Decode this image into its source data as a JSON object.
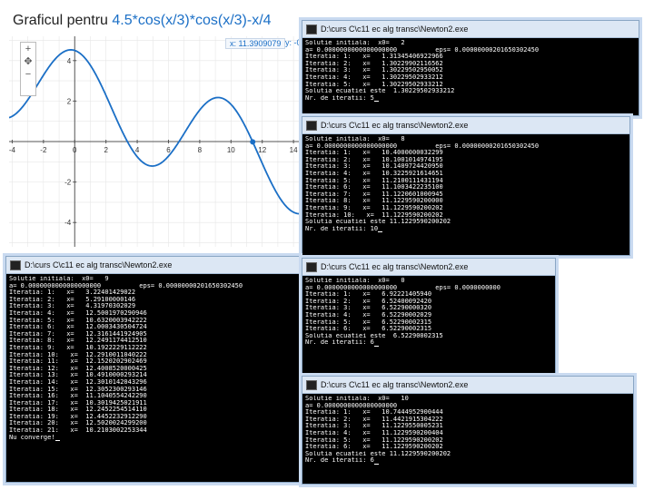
{
  "graph": {
    "title_prefix": "Graficul pentru ",
    "function": "4.5*cos(x/3)*cos(x/3)-x/4",
    "x_readout": "x: 11.3909079",
    "y_readout": "y: -0",
    "zoom_in": "+",
    "zoom_out": "−",
    "x_ticks": [
      "-4",
      "-2",
      "0",
      "2",
      "4",
      "6",
      "8",
      "10",
      "12",
      "14"
    ],
    "y_ticks": [
      "4",
      "2",
      "-2",
      "-4"
    ],
    "colors": {
      "curve": "#1b6fc6",
      "axis": "#555555",
      "grid": "#e6e6e6"
    }
  },
  "consoles": [
    {
      "title": "D:\\curs C\\c11 ec alg transc\\Newton2.exe",
      "lines": [
        "Solutie initiala:  x0=   2",
        "a= 0.0000000000000000000          eps= 0.00000000201650302450",
        "Iteratia: 1:   x=   1.31345406922966",
        "Iteratia: 2:   x=   1.30229902116562",
        "Iteratia: 3:   x=   1.30229502950052",
        "Iteratia: 4:   x=   1.30229502933212",
        "Iteratia: 5:   x=   1.30229502933212",
        "Solutia ecuatiei este  1.30229502933212",
        "Nr. de iteratii: 5"
      ]
    },
    {
      "title": "D:\\curs C\\c11 ec alg transc\\Newton2.exe",
      "lines": [
        "Solutie initiala:  x0=   8",
        "a= 0.0000000000000000000          eps= 0.00000000201650302450",
        "Iteratia: 1:   x=   10.4000000032299",
        "Iteratia: 2:   x=   10.1001014974195",
        "Iteratia: 3:   x=   10.1409724420950",
        "Iteratia: 4:   x=   10.3225921614651",
        "Iteratia: 5:   x=   11.2100111431194",
        "Iteratia: 6:   x=   11.1003422235100",
        "Iteratia: 7:   x=   11.1220601000945",
        "Iteratia: 8:   x=   11.1229590200000",
        "Iteratia: 9:   x=   11.1229590200202",
        "Iteratia: 10:   x=  11.1229590200202",
        "Solutia ecuatiei este 11.1229590200202",
        "Nr. de iteratii: 10"
      ]
    },
    {
      "title": "D:\\curs C\\c11 ec alg transc\\Newton2.exe",
      "lines": [
        "Solutie initiala:  x0=   9",
        "a= 0.0000000000000000000          eps= 0.00000000201650302450",
        "Iteratia: 1:   x=   3.22401429022",
        "Iteratia: 2:   x=   5.29100000146",
        "Iteratia: 3:   x=   4.31970302029",
        "Iteratia: 4:   x=   12.5001970290946",
        "Iteratia: 5:   x=   10.6320003942222",
        "Iteratia: 6:   x=   12.0003430504724",
        "Iteratia: 7:   x=   12.3161441924905",
        "Iteratia: 8:   x=   12.2491174412510",
        "Iteratia: 9:   x=   10.1922229112222",
        "Iteratia: 10:   x=  12.2910011040222",
        "Iteratia: 11:   x=  12.1520202902469",
        "Iteratia: 12:   x=  12.4008520000425",
        "Iteratia: 13:   x=  10.4910000293214",
        "Iteratia: 14:   x=  12.3010142043296",
        "Iteratia: 15:   x=  12.3052300293146",
        "Iteratia: 16:   x=  11.1040554242290",
        "Iteratia: 17:   x=  10.3019425021911",
        "Iteratia: 18:   x=  12.2452254514110",
        "Iteratia: 19:   x=  12.4452232912290",
        "Iteratia: 20:   x=  12.5020024299200",
        "Iteratia: 21:   x=  10.2103002253344",
        "Nu converge!"
      ]
    },
    {
      "title": "D:\\curs C\\c11 ec alg transc\\Newton2.exe",
      "lines": [
        "Solutie initiala:  x0=   0",
        "a= 0.0000000000000000000          eps= 0.0000000000",
        "Iteratia: 1:   x=   6.92221405940",
        "Iteratia: 2:   x=   6.52400092420",
        "Iteratia: 3:   x=   6.52290000320",
        "Iteratia: 4:   x=   6.52290002029",
        "Iteratia: 5:   x=   6.52290002315",
        "Iteratia: 6:   x=   6.52290002315",
        "Solutia ecuatiei este  6.52290002315",
        "Nr. de iteratii: 6"
      ]
    },
    {
      "title": "D:\\curs C\\c11 ec alg transc\\Newton2.exe",
      "lines": [
        "Solutie initiala:  x0=   10",
        "a= 0.0000000000000000000",
        "Iteratia: 1:   x=   10.7444952900444",
        "Iteratia: 2:   x=   11.4421915304222",
        "Iteratia: 3:   x=   11.1229550005231",
        "Iteratia: 4:   x=   11.1229590200404",
        "Iteratia: 5:   x=   11.1229590200202",
        "Iteratia: 6:   x=   11.1229590200202",
        "Solutia ecuatiei este 11.1229590200202",
        "Nr. de iteratii: 6"
      ]
    }
  ]
}
